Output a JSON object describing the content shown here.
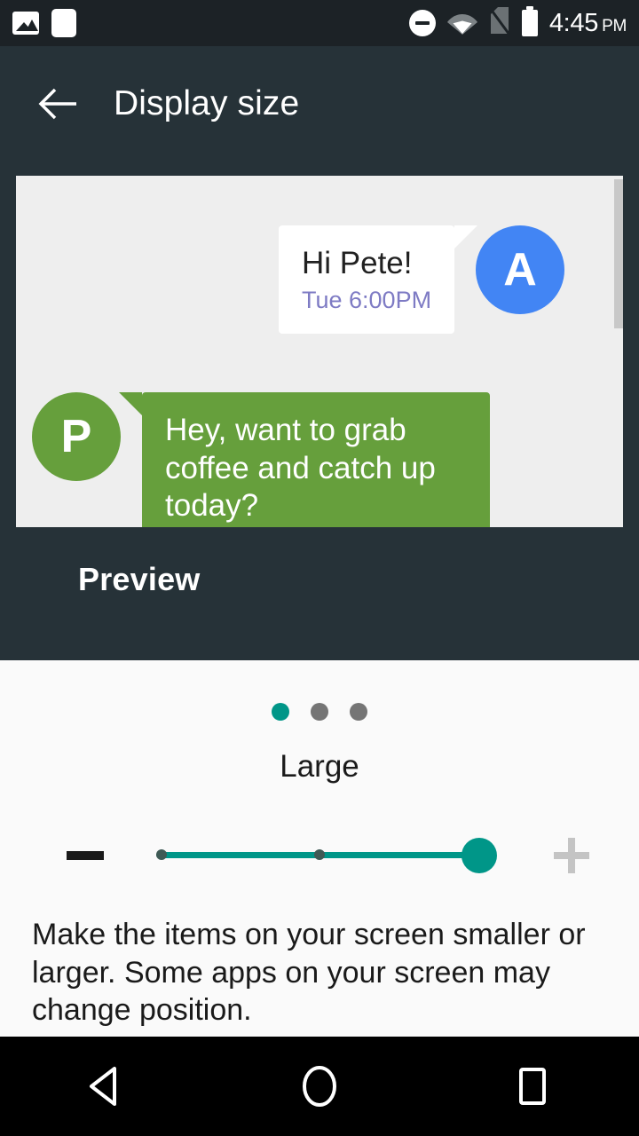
{
  "statusbar": {
    "time": "4:45",
    "ampm": "PM",
    "icons": [
      "image-icon",
      "square-icon",
      "do-not-disturb-icon",
      "wifi-icon",
      "sim-card-off-icon",
      "battery-icon"
    ]
  },
  "appbar": {
    "back_icon": "back-arrow-icon",
    "title": "Display size"
  },
  "preview": {
    "label": "Preview",
    "messages": [
      {
        "avatar": "A",
        "avatar_color": "#4285f4",
        "text": "Hi Pete!",
        "time": "Tue 6:00PM",
        "side": "outgoing"
      },
      {
        "avatar": "P",
        "avatar_color": "#669f3c",
        "text": "Hey, want to grab coffee and catch up today?",
        "side": "incoming"
      }
    ]
  },
  "settings": {
    "dots": [
      {
        "active": true
      },
      {
        "active": false
      },
      {
        "active": false
      }
    ],
    "size_label": "Large",
    "decrease_label": "minus-icon",
    "increase_label": "plus-icon",
    "slider": {
      "value": 3,
      "min": 1,
      "max": 3,
      "ticks": 3
    },
    "description": "Make the items on your screen smaller or larger. Some apps on your screen may change position."
  },
  "navbar": {
    "back": "back-triangle-icon",
    "home": "home-circle-icon",
    "recents": "recents-square-icon"
  },
  "colors": {
    "accent": "#009688",
    "appbar": "#263238",
    "statusbar": "#1c2226",
    "card": "#eeeeee",
    "bubble_green": "#669f3c",
    "avatar_blue": "#4285f4",
    "timestamp": "#7e7bc4"
  }
}
